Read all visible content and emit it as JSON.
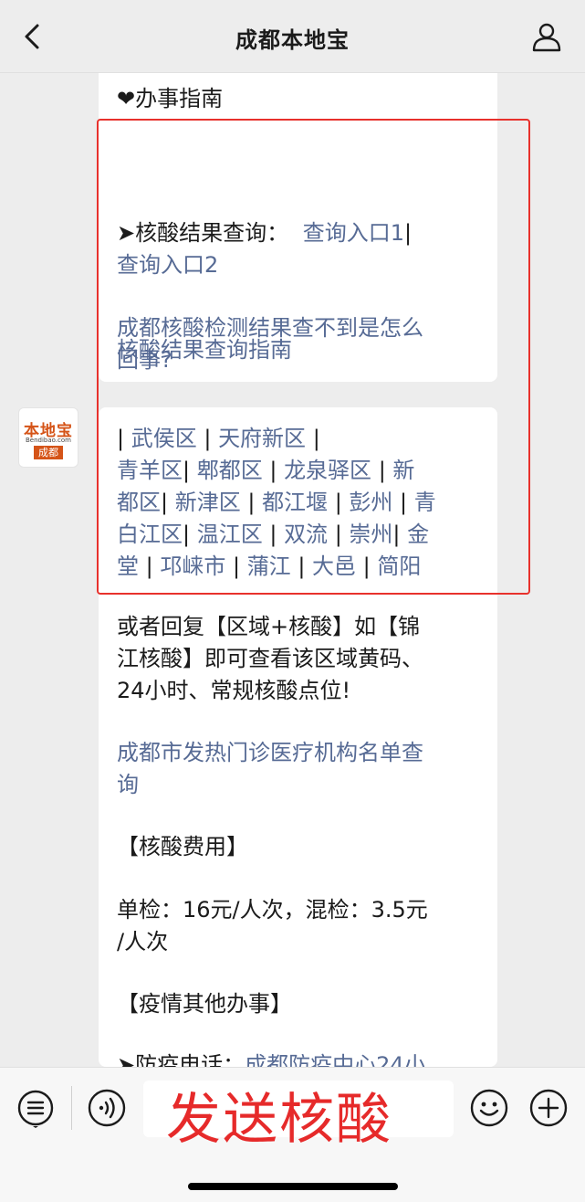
{
  "header": {
    "title": "成都本地宝"
  },
  "avatar": {
    "brand": "本地宝",
    "sub": "Bendibao.com",
    "city": "成都"
  },
  "card1": {
    "section_title": "❤办事指南",
    "query_label": "➤核酸结果查询：",
    "query_link1": "查询入口1",
    "query_sep": "|",
    "query_link2": "查询入口2",
    "faq_line1": "成都核酸检测结果查不到是怎么",
    "faq_line2": "回事?",
    "guide": "核酸结果查询指南"
  },
  "districts": {
    "lines": [
      [
        "| ",
        "武侯区",
        " | ",
        "天府新区",
        " |"
      ],
      [
        "青羊区",
        "| ",
        "郫都区",
        " |  ",
        "龙泉驿区",
        " | ",
        "新"
      ],
      [
        "都区",
        "| ",
        "新津区",
        " | ",
        "都江堰",
        " | ",
        "彭州",
        " | ",
        "青"
      ],
      [
        "白江区",
        "| ",
        "温江区",
        " | ",
        "双流",
        " | ",
        "崇州",
        "| ",
        "金"
      ],
      [
        "堂",
        " | ",
        "邛崃市",
        " | ",
        "蒲江",
        " | ",
        "大邑",
        " | ",
        "简阳"
      ]
    ]
  },
  "info": {
    "reply_line1": "或者回复【区域+核酸】如【锦",
    "reply_line2": "江核酸】即可查看该区域黄码、",
    "reply_line3": "24小时、常规核酸点位!",
    "fever_line1": "成都市发热门诊医疗机构名单查",
    "fever_line2": "询",
    "cost_heading": "【核酸费用】",
    "cost_line1": "单检：16元/人次，混检：3.5元",
    "cost_line2": "/人次",
    "other_heading": "【疫情其他办事】",
    "hotline_label": "➤防疫电话：",
    "hotline_link": "成都防疫中心24小"
  },
  "bottom": {
    "send_text": "发送核酸",
    "menu_icon": "menu-list-icon",
    "voice_icon": "voice-icon",
    "emoji_icon": "emoji-icon",
    "plus_icon": "plus-icon"
  },
  "colors": {
    "link": "#576b95",
    "highlight_box": "#e8312c",
    "brand": "#d55418"
  }
}
